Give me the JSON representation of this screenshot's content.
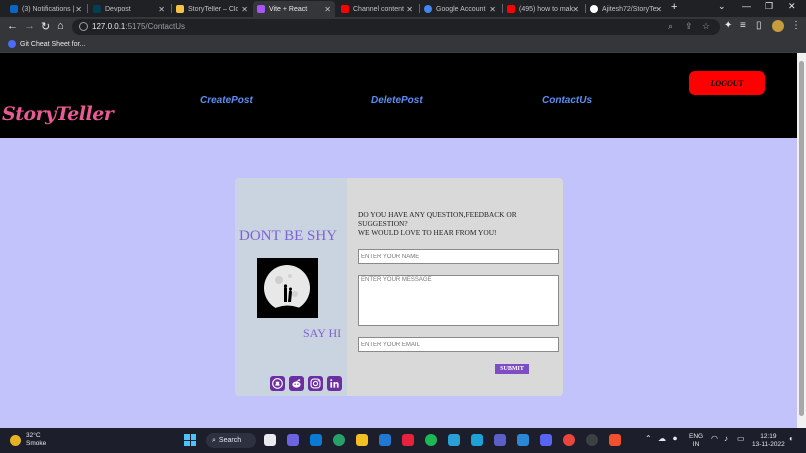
{
  "browser": {
    "tabs": [
      {
        "title": "(3) Notifications |",
        "color": "#0a66c2"
      },
      {
        "title": "Devpost",
        "color": "#003e54"
      },
      {
        "title": "StoryTeller – Cloc",
        "color": "#f5c542"
      },
      {
        "title": "Vite + React",
        "color": "#a855f7"
      },
      {
        "title": "Channel content",
        "color": "#ff0000"
      },
      {
        "title": "Google Account",
        "color": "#4285f4"
      },
      {
        "title": "(495) how to mak",
        "color": "#ff0000"
      },
      {
        "title": "Ajitesh72/StoryTe",
        "color": "#ffffff"
      }
    ],
    "url_host": "127.0.0.1",
    "url_path": ":5175/ContactUs",
    "bookmark": "Git Cheat Sheet for..."
  },
  "site": {
    "logo": "StoryTeller",
    "nav": [
      "CreatePost",
      "DeletePost",
      "ContactUs"
    ],
    "logout": "LOGOUT"
  },
  "contact": {
    "heading": "DONT BE SHY",
    "say_hi": "SAY HI",
    "question_line1": "DO YOU HAVE ANY QUESTION,FEEDBACK OR SUGGESTION?",
    "question_line2": "WE WOULD LOVE TO HEAR FROM YOU!",
    "name_placeholder": "ENTER YOUR NAME",
    "message_placeholder": "ENTER YOUR MESSAGE",
    "email_placeholder": "ENTER YOUR EMAIL",
    "submit": "SUBMIT",
    "social": [
      "github-icon",
      "reddit-icon",
      "instagram-icon",
      "linkedin-icon"
    ]
  },
  "taskbar": {
    "temperature": "32°C",
    "weather": "Smoke",
    "search": "Search",
    "lang1": "ENG",
    "lang2": "IN",
    "time": "12:19",
    "date": "13-11-2022"
  }
}
